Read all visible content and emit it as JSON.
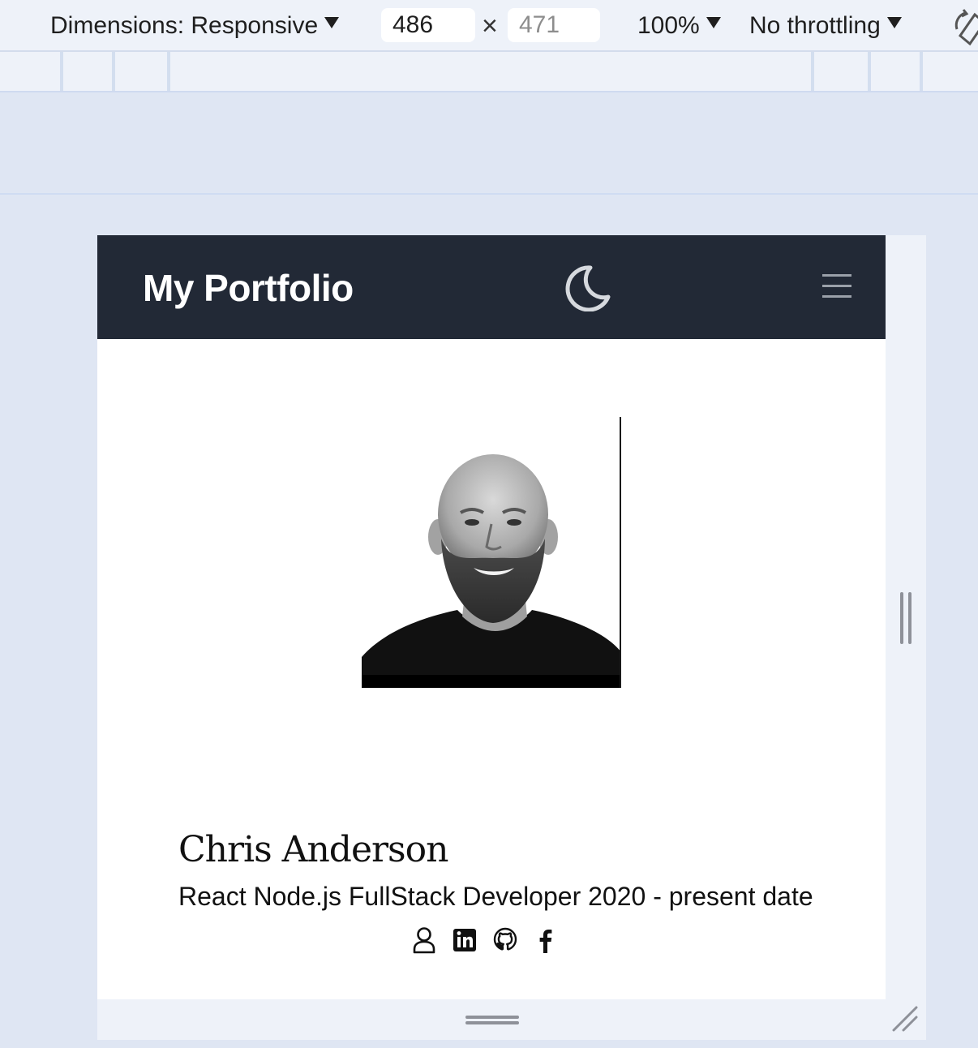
{
  "devtools": {
    "dimensions_label": "Dimensions: Responsive",
    "width_value": "486",
    "height_placeholder": "471",
    "times_sign": "×",
    "zoom_label": "100%",
    "throttling_label": "No throttling"
  },
  "site": {
    "brand": "My Portfolio",
    "profile": {
      "name": "Chris Anderson",
      "role": "React Node.js FullStack Developer 2020 - present date"
    },
    "social_icons": [
      "user-icon",
      "linkedin-icon",
      "github-icon",
      "facebook-icon"
    ]
  },
  "colors": {
    "navbar_bg": "#222936",
    "brand_text": "#ffffff",
    "devtools_bg": "#eef2f9",
    "canvas_bg": "#dfe6f3"
  }
}
